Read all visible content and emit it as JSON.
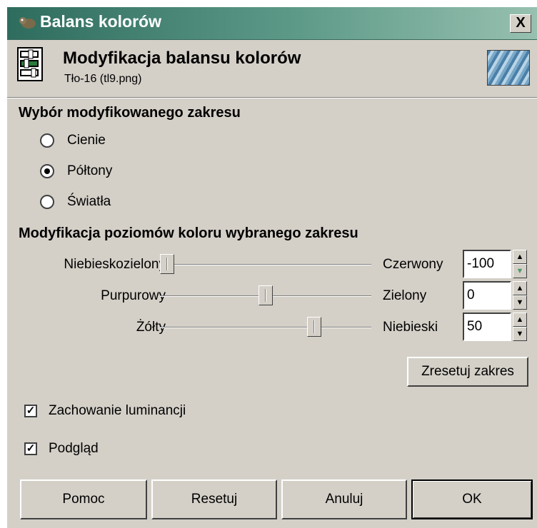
{
  "window": {
    "title": "Balans kolorów",
    "close_label": "X"
  },
  "header": {
    "title": "Modyfikacja balansu kolorów",
    "subtitle": "Tło-16 (tl9.png)"
  },
  "range_section": {
    "title": "Wybór modyfikowanego zakresu",
    "options": [
      {
        "label": "Cienie",
        "selected": false
      },
      {
        "label": "Półtony",
        "selected": true
      },
      {
        "label": "Światła",
        "selected": false
      }
    ]
  },
  "levels_section": {
    "title": "Modyfikacja poziomów koloru wybranego zakresu",
    "sliders": [
      {
        "left_label": "Niebieskozielony",
        "right_label": "Czerwony",
        "value": "-100",
        "level": 0.0
      },
      {
        "left_label": "Purpurowy",
        "right_label": "Zielony",
        "value": "0",
        "level": 0.5
      },
      {
        "left_label": "Żółty",
        "right_label": "Niebieski",
        "value": "50",
        "level": 0.75
      }
    ],
    "reset_range_label": "Zresetuj zakres"
  },
  "checkboxes": [
    {
      "label": "Zachowanie luminancji",
      "checked": true
    },
    {
      "label": "Podgląd",
      "checked": true
    }
  ],
  "buttons": {
    "help": "Pomoc",
    "reset": "Resetuj",
    "cancel": "Anuluj",
    "ok": "OK"
  }
}
